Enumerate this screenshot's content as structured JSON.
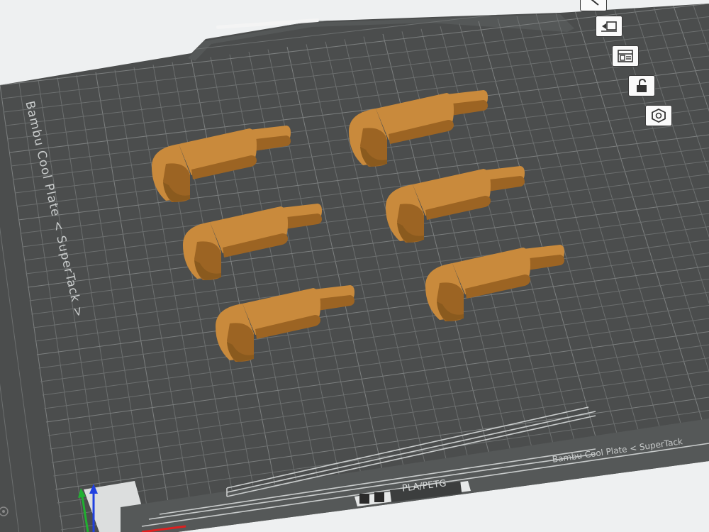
{
  "plate": {
    "name_left": "Bambu Cool Plate < SuperTack >",
    "name_right": "Bambu Cool Plate < SuperTack",
    "material": "PLA/PETG"
  },
  "parts": [
    {
      "name": "elbow-part-1"
    },
    {
      "name": "elbow-part-2"
    },
    {
      "name": "elbow-part-3"
    },
    {
      "name": "elbow-part-4"
    },
    {
      "name": "elbow-part-5"
    },
    {
      "name": "elbow-part-6"
    }
  ],
  "toolbar": [
    {
      "name": "move-tool-button",
      "icon": "arrow-icon"
    },
    {
      "name": "auto-orient-button",
      "icon": "auto-orient-icon"
    },
    {
      "name": "arrange-button",
      "icon": "layout-icon"
    },
    {
      "name": "lock-plate-button",
      "icon": "unlock-icon"
    },
    {
      "name": "plate-settings-button",
      "icon": "hexagon-icon"
    }
  ],
  "colors": {
    "plate": "#4b4d4d",
    "grid": "#6c6f6f",
    "part_top": "#c98a3c",
    "part_side": "#9c6423",
    "axis_x": "#e02020",
    "axis_y": "#20b030",
    "axis_z": "#2040e0"
  }
}
